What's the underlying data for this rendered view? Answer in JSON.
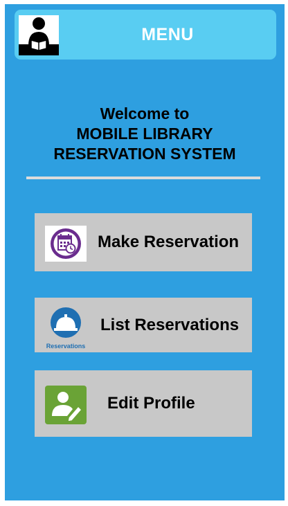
{
  "header": {
    "title": "MENU",
    "logo_icon": "reader-icon"
  },
  "welcome": {
    "line1": "Welcome to",
    "line2": "MOBILE LIBRARY",
    "line3": "RESERVATION SYSTEM"
  },
  "menu": {
    "items": [
      {
        "label": "Make Reservation",
        "icon": "calendar-clock-icon",
        "icon_color": "#6a2c8e"
      },
      {
        "label": "List Reservations",
        "icon": "service-bell-icon",
        "icon_caption": "Reservations",
        "icon_color": "#1f6fb2"
      },
      {
        "label": "Edit Profile",
        "icon": "user-edit-icon",
        "icon_color": "#6aa336"
      }
    ]
  },
  "colors": {
    "background": "#2e9fe0",
    "header": "#59cdf2",
    "button": "#c8c8c8"
  }
}
